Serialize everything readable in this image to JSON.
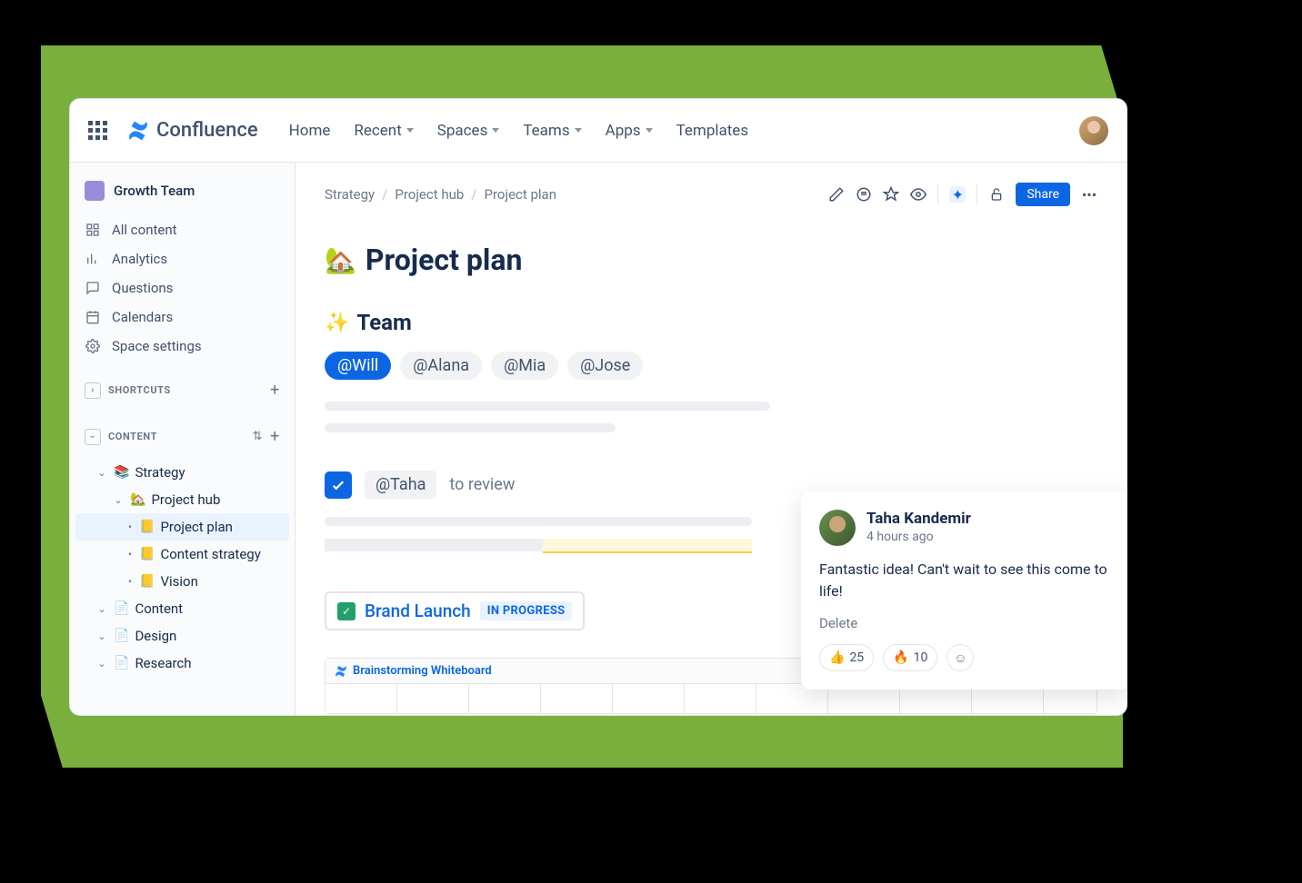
{
  "header": {
    "logo_text": "Confluence",
    "nav": [
      "Home",
      "Recent",
      "Spaces",
      "Teams",
      "Apps",
      "Templates"
    ],
    "nav_has_dropdown": [
      false,
      true,
      true,
      true,
      true,
      false
    ]
  },
  "sidebar": {
    "space_name": "Growth Team",
    "items": [
      {
        "label": "All content",
        "icon": "grid-icon"
      },
      {
        "label": "Analytics",
        "icon": "chart-icon"
      },
      {
        "label": "Questions",
        "icon": "question-icon"
      },
      {
        "label": "Calendars",
        "icon": "calendar-icon"
      },
      {
        "label": "Space settings",
        "icon": "gear-icon"
      }
    ],
    "shortcuts_label": "SHORTCUTS",
    "content_label": "CONTENT",
    "tree": [
      {
        "label": "Strategy",
        "emoji": "📚",
        "depth": 1,
        "chev": "down"
      },
      {
        "label": "Project hub",
        "emoji": "🏡",
        "depth": 2,
        "chev": "down"
      },
      {
        "label": "Project plan",
        "emoji": "📒",
        "depth": 3,
        "bullet": true,
        "selected": true
      },
      {
        "label": "Content strategy",
        "emoji": "📒",
        "depth": 3,
        "bullet": true
      },
      {
        "label": "Vision",
        "emoji": "📒",
        "depth": 3,
        "bullet": true
      },
      {
        "label": "Content",
        "emoji": "📄",
        "depth": 1,
        "chev": "down"
      },
      {
        "label": "Design",
        "emoji": "📄",
        "depth": 1,
        "chev": "down"
      },
      {
        "label": "Research",
        "emoji": "📄",
        "depth": 1,
        "chev": "down"
      }
    ]
  },
  "breadcrumb": [
    "Strategy",
    "Project hub",
    "Project plan"
  ],
  "toolbar": {
    "share_label": "Share"
  },
  "page": {
    "title": "Project plan",
    "title_emoji": "🏡",
    "team_heading": "Team",
    "team_emoji": "✨",
    "mentions": [
      {
        "label": "@Will",
        "active": true
      },
      {
        "label": "@Alana",
        "active": false
      },
      {
        "label": "@Mia",
        "active": false
      },
      {
        "label": "@Jose",
        "active": false
      }
    ],
    "task_mention": "@Taha",
    "task_suffix": "to review",
    "brand_task": "Brand Launch",
    "brand_status": "IN PROGRESS",
    "whiteboard_title": "Brainstorming Whiteboard"
  },
  "comment": {
    "author": "Taha Kandemir",
    "time": "4 hours ago",
    "body": "Fantastic idea! Can't wait to see this come to life!",
    "delete_label": "Delete",
    "reactions": [
      {
        "emoji": "👍",
        "count": "25"
      },
      {
        "emoji": "🔥",
        "count": "10"
      }
    ]
  }
}
